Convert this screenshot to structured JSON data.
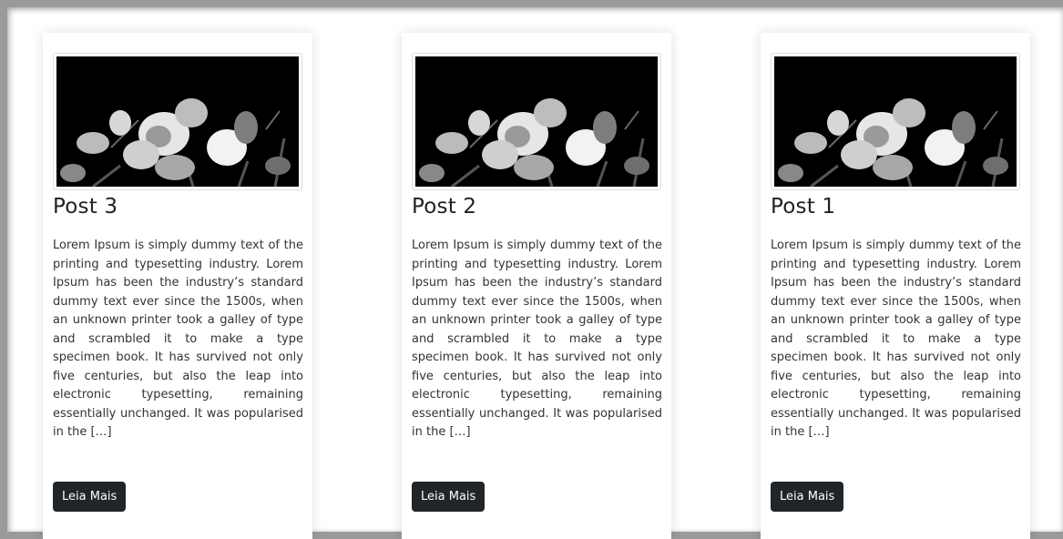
{
  "posts": [
    {
      "title": "Post 3",
      "excerpt": "Lorem Ipsum is simply dummy text of the printing and typesetting industry. Lorem Ipsum has been the industry’s standard dummy text ever since the 1500s, when an unknown printer took a galley of type and scrambled it to make a type specimen book. It has survived not only five centuries, but also the leap into electronic typesetting, remaining essentially unchanged. It was popularised in the […]",
      "button_label": "Leia Mais"
    },
    {
      "title": "Post 2",
      "excerpt": "Lorem Ipsum is simply dummy text of the printing and typesetting industry. Lorem Ipsum has been the industry’s standard dummy text ever since the 1500s, when an unknown printer took a galley of type and scrambled it to make a type specimen book. It has survived not only five centuries, but also the leap into electronic typesetting, remaining essentially unchanged. It was popularised in the […]",
      "button_label": "Leia Mais"
    },
    {
      "title": "Post 1",
      "excerpt": "Lorem Ipsum is simply dummy text of the printing and typesetting industry. Lorem Ipsum has been the industry’s standard dummy text ever since the 1500s, when an unknown printer took a galley of type and scrambled it to make a type specimen book. It has survived not only five centuries, but also the leap into electronic typesetting, remaining essentially unchanged. It was popularised in the […]",
      "button_label": "Leia Mais"
    }
  ],
  "colors": {
    "button_bg": "#212529",
    "button_text": "#ffffff",
    "image_bg": "#000000"
  }
}
